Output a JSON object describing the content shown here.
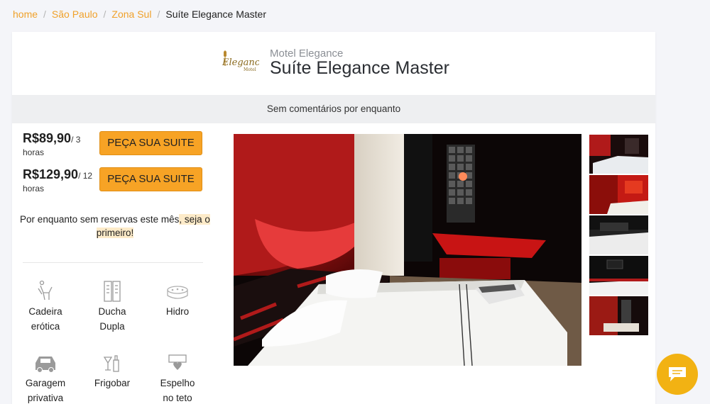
{
  "breadcrumb": {
    "items": [
      "home",
      "São Paulo",
      "Zona Sul"
    ],
    "current": "Suíte Elegance Master",
    "separator": "/"
  },
  "header": {
    "logo_text": "Elegance",
    "logo_sub": "Motel",
    "motel_name": "Motel Elegance",
    "suite_title": "Suíte Elegance Master"
  },
  "comments": {
    "text": "Sem comentários por enquanto"
  },
  "prices": [
    {
      "price": "R$89,90",
      "unit": "/ 3",
      "hours": "horas",
      "button": "PEÇA SUA SUITE"
    },
    {
      "price": "R$129,90",
      "unit": "/ 12",
      "hours": "horas",
      "button": "PEÇA SUA SUITE"
    }
  ],
  "reservation": {
    "text": "Por enquanto sem reservas este mês",
    "highlight_1": ", seja o",
    "highlight_2": "primeiro!"
  },
  "amenities": [
    {
      "line1": "Cadeira",
      "line2": "erótica",
      "icon": "chair-icon"
    },
    {
      "line1": "Ducha",
      "line2": "Dupla",
      "icon": "shower-icon"
    },
    {
      "line1": "Hidro",
      "line2": "",
      "icon": "hot-tub-icon"
    },
    {
      "line1": "Garagem",
      "line2": "privativa",
      "icon": "car-icon"
    },
    {
      "line1": "Frigobar",
      "line2": "",
      "icon": "drinks-icon"
    },
    {
      "line1": "Espelho",
      "line2": "no teto",
      "icon": "ceiling-mirror-icon"
    }
  ],
  "colors": {
    "accent": "#f7a325",
    "breadcrumb_link": "#f0a12a",
    "chat_button": "#f2b213",
    "highlight_bg": "#fdebc9"
  },
  "chat": {
    "icon": "chat-icon"
  }
}
